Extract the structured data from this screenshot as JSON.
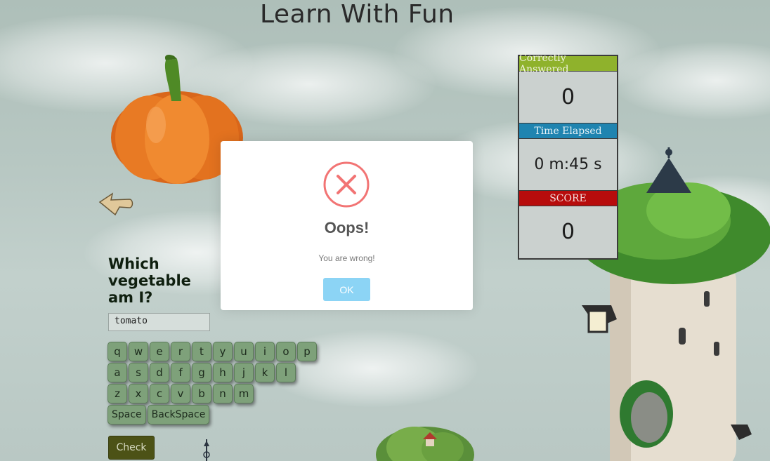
{
  "page": {
    "title": "Learn With Fun"
  },
  "quiz": {
    "question": "Which vegetable am I?",
    "answer_value": "tomato",
    "check_label": "Check",
    "image_icon": "pumpkin-image",
    "back_icon": "back-arrow-icon"
  },
  "keyboard": {
    "rows": [
      [
        "q",
        "w",
        "e",
        "r",
        "t",
        "y",
        "u",
        "i",
        "o",
        "p"
      ],
      [
        "a",
        "s",
        "d",
        "f",
        "g",
        "h",
        "j",
        "k",
        "l"
      ],
      [
        "z",
        "x",
        "c",
        "v",
        "b",
        "n",
        "m"
      ]
    ],
    "space_label": "Space",
    "backspace_label": "BackSpace"
  },
  "scoreboard": {
    "correct_label": "Correctly Answered",
    "correct_value": "0",
    "time_label": "Time Elapsed",
    "time_value": "0 m:45 s",
    "score_label": "SCORE",
    "score_value": "0",
    "colors": {
      "correct": "#8fb22c",
      "time": "#1f84b0",
      "score": "#b70c0c"
    }
  },
  "dialog": {
    "icon": "error-x-icon",
    "title": "Oops!",
    "message": "You are wrong!",
    "ok_label": "OK",
    "colors": {
      "icon": "#f27474",
      "ok": "#8cd4f5"
    }
  }
}
